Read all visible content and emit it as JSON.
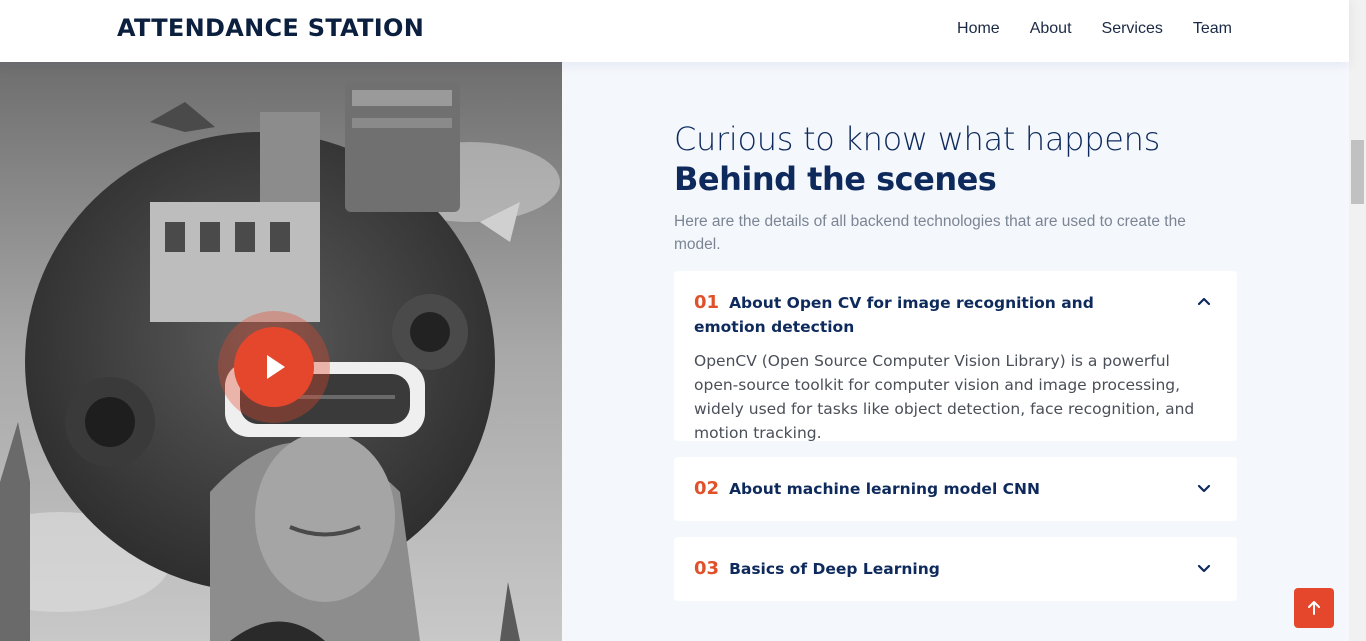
{
  "header": {
    "logo": "ATTENDANCE STATION",
    "nav": [
      {
        "label": "Home"
      },
      {
        "label": "About"
      },
      {
        "label": "Services"
      },
      {
        "label": "Team"
      }
    ]
  },
  "hero": {
    "image_icon": "play-icon",
    "accent_color": "#e5472c"
  },
  "section": {
    "heading_light": "Curious to know what happens",
    "heading_bold": "Behind the scenes",
    "subtitle": "Here are the details of all backend technologies that are used to create the model."
  },
  "faqs": [
    {
      "number": "01",
      "question": "About Open CV for image recognition and emotion detection",
      "answer": "OpenCV (Open Source Computer Vision Library) is a powerful open-source toolkit for computer vision and image processing, widely used for tasks like object detection, face recognition, and motion tracking.",
      "expanded": true
    },
    {
      "number": "02",
      "question": "About machine learning model CNN",
      "expanded": false
    },
    {
      "number": "03",
      "question": "Basics of Deep Learning",
      "expanded": false
    }
  ],
  "colors": {
    "navy": "#0e2a5c",
    "accent": "#e0512a",
    "background": "#f4f7fc"
  }
}
